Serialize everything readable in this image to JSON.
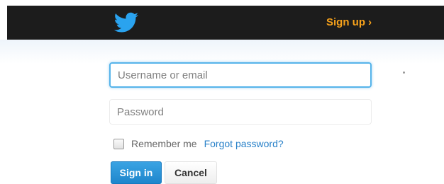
{
  "header": {
    "signup_label": "Sign up ›",
    "logo_icon": "twitter-bird-icon",
    "colors": {
      "bar": "#1c1c1c",
      "signup": "#f7a21b",
      "logo": "#2aa3ef"
    }
  },
  "form": {
    "username_placeholder": "Username or email",
    "password_placeholder": "Password",
    "remember_label": "Remember me",
    "remember_checked": false,
    "forgot_label": "Forgot password?",
    "signin_label": "Sign in",
    "cancel_label": "Cancel",
    "colors": {
      "link": "#2a82c9",
      "primary": "#2394dd",
      "focus": "#56b4ea"
    }
  }
}
